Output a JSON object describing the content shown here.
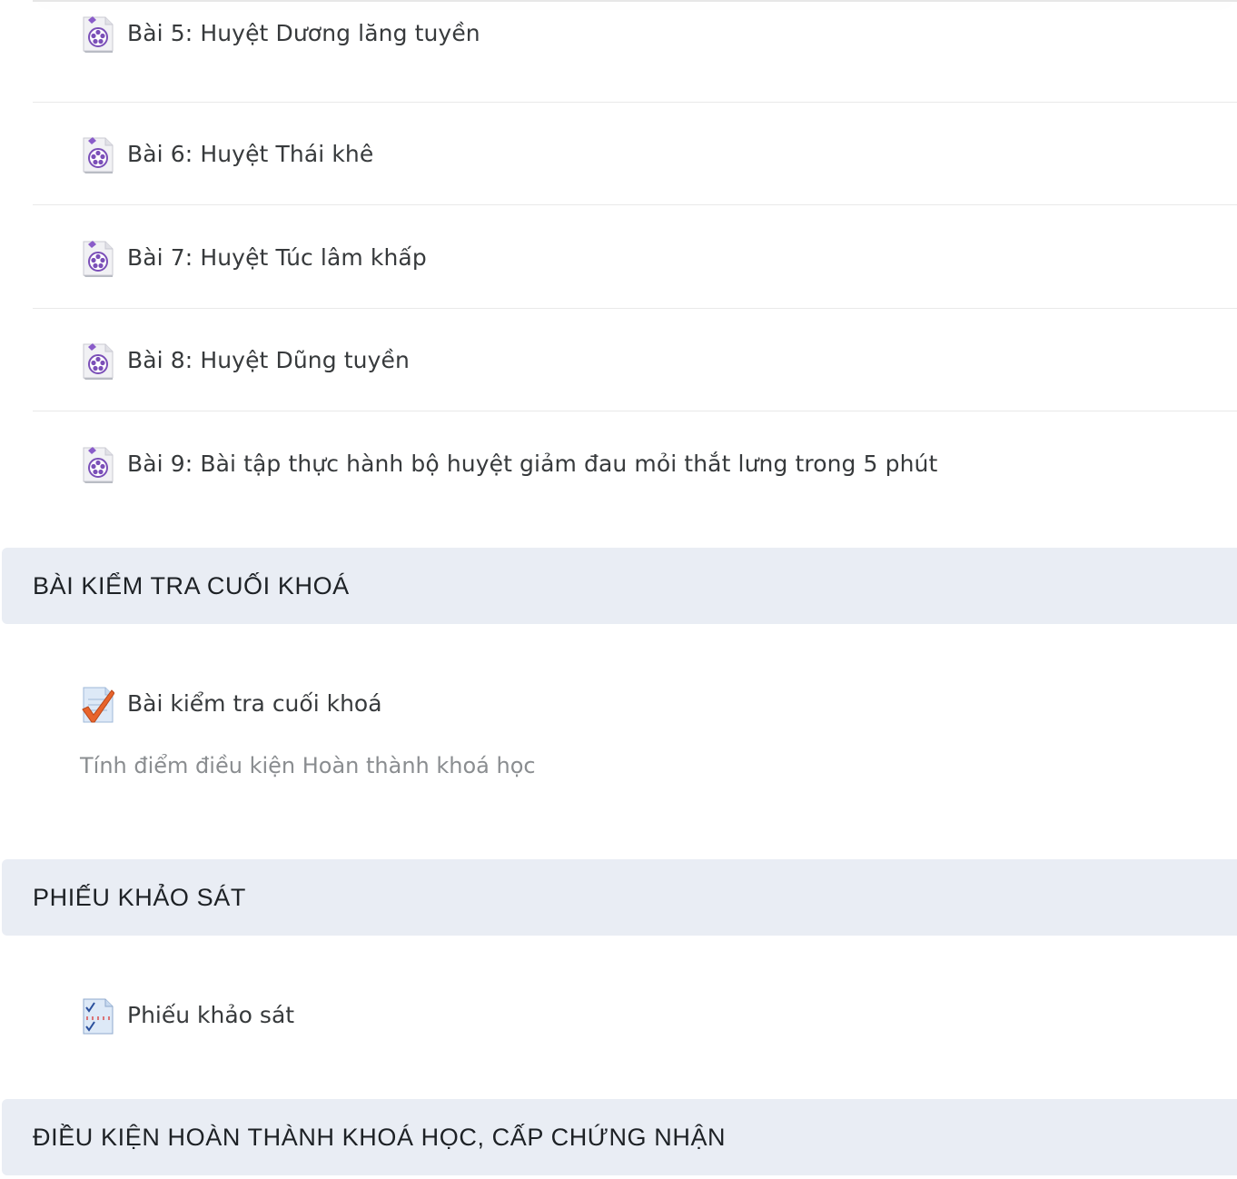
{
  "lessons": [
    {
      "label": "Bài 5: Huyệt Dương lăng tuyền",
      "icon": "video-file-icon"
    },
    {
      "label": "Bài 6: Huyệt Thái khê",
      "icon": "video-file-icon"
    },
    {
      "label": "Bài 7: Huyệt Túc lâm khấp",
      "icon": "video-file-icon"
    },
    {
      "label": "Bài 8: Huyệt Dũng tuyền",
      "icon": "video-file-icon"
    },
    {
      "label": "Bài 9: Bài tập thực hành bộ huyệt giảm đau mỏi thắt lưng trong 5 phút",
      "icon": "video-file-icon"
    }
  ],
  "sections": [
    {
      "title": "BÀI KIỂM TRA CUỐI KHOÁ",
      "activity": {
        "label": "Bài kiểm tra cuối khoá",
        "icon": "quiz-icon"
      },
      "description": "Tính điểm điều kiện Hoàn thành khoá học"
    },
    {
      "title": "PHIẾU KHẢO SÁT",
      "activity": {
        "label": "Phiếu khảo sát",
        "icon": "survey-icon"
      }
    },
    {
      "title": "ĐIỀU KIỆN HOÀN THÀNH KHOÁ HỌC, CẤP CHỨNG NHẬN"
    }
  ],
  "colors": {
    "section_bg": "#e9edf4",
    "text": "#373a3c",
    "muted": "#8a8d90",
    "quiz_check": "#e8642c",
    "icon_purple": "#7b4fb8"
  }
}
